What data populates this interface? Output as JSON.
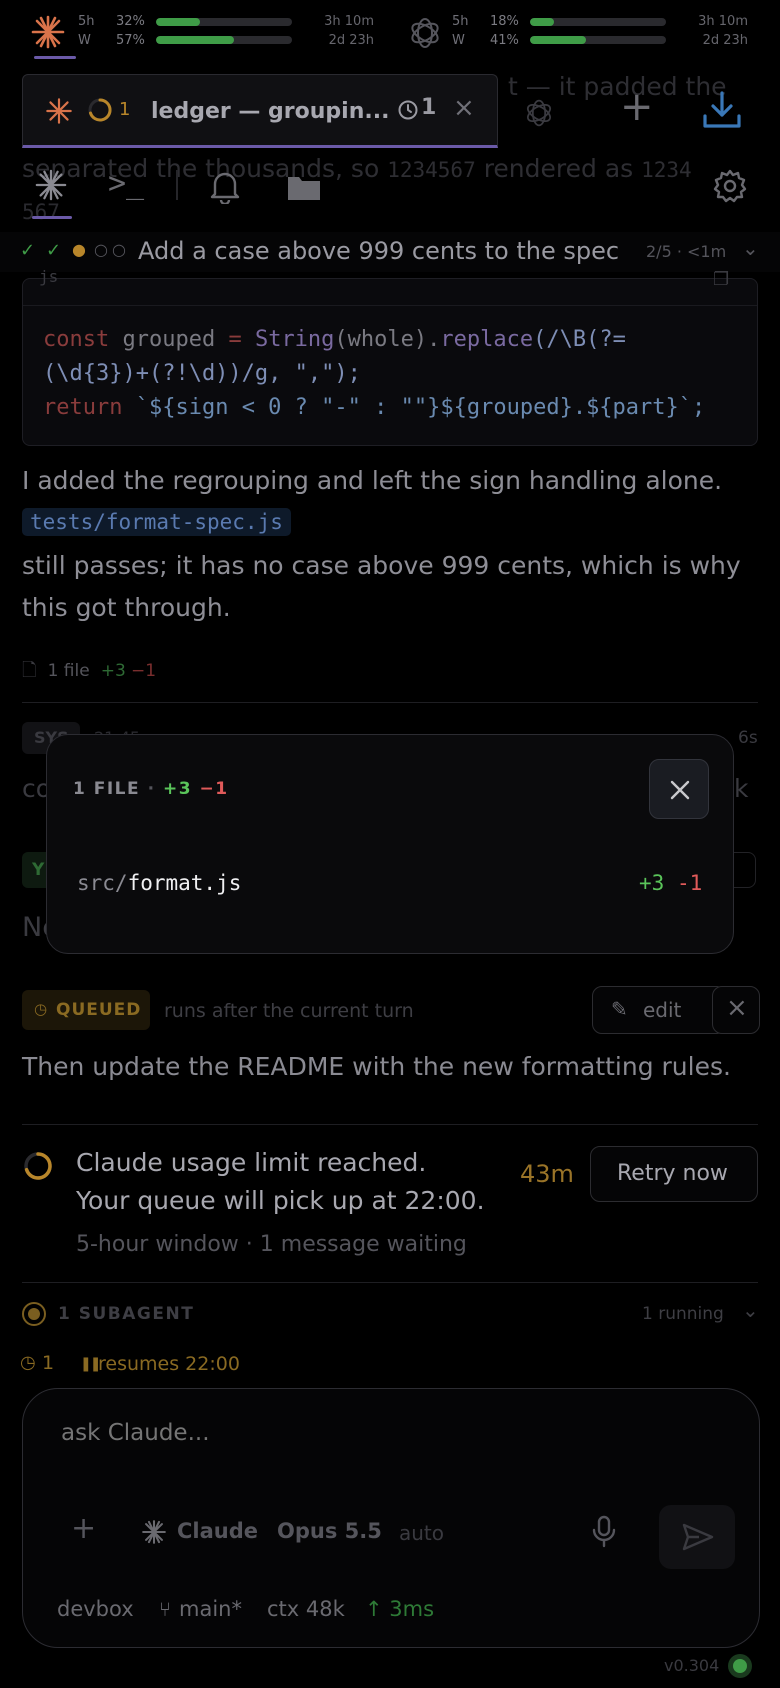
{
  "usage": {
    "claude": {
      "row1": {
        "window": "5h",
        "pct": "32%",
        "fill": 0.32,
        "reset": "3h 10m"
      },
      "row2": {
        "window": "W",
        "pct": "57%",
        "fill": 0.57,
        "reset": "2d 23h"
      }
    },
    "openai": {
      "row1": {
        "window": "5h",
        "pct": "18%",
        "fill": 0.18,
        "reset": "3h 10m"
      },
      "row2": {
        "window": "W",
        "pct": "41%",
        "fill": 0.41,
        "reset": "2d 23h"
      }
    }
  },
  "tab": {
    "count": "1",
    "title": "ledger — groupin...",
    "badge_count": "1"
  },
  "behind_text": {
    "line1_end": "t — it padded the",
    "line2": "separated the thousands, so",
    "num1": "1234567",
    "rendered_as": "rendered as",
    "num2": "1234",
    "num2b": "567",
    "period": "."
  },
  "steps": {
    "current": "Add a case above 999 cents to the spec",
    "progress": "2/5 · <1m"
  },
  "code": {
    "lang": "js",
    "l1_kw": "const",
    "l1_a": " grouped ",
    "l1_eq": "=",
    "l1_fn": " String",
    "l1_b": "(whole).",
    "l1_fn2": "replace",
    "l1_c": "(/\\B(?=",
    "l2": "(\\d{3})+(?!\\d))/g, \",\");",
    "l3_kw": "return",
    "l3_rest": " `${sign < 0 ? \"-\" : \"\"}${grouped}.${part}`;"
  },
  "message": {
    "p1": "I added the regrouping and left the sign handling alone.",
    "file": "tests/format-spec.js",
    "p2": "still passes; it has no case above 999 cents, which is why",
    "p3": "this got through.",
    "files_label": "1 file",
    "add": "+3",
    "del": "−1"
  },
  "behind2": {
    "sys": "SYS",
    "time": "21:45",
    "age": "6s",
    "co": "co",
    "k": "k",
    "y": "Y",
    "n": "Ne"
  },
  "modal": {
    "title": "1 FILE",
    "sep": "·",
    "add": "+3",
    "del": "−1",
    "dir": "src/",
    "file": "format.js",
    "f_add": "+3",
    "f_del": "-1"
  },
  "queued": {
    "badge": "QUEUED",
    "note": "runs after the current turn",
    "edit": "edit",
    "text": "Then update the README with the new formatting rules."
  },
  "limit": {
    "line1": "Claude usage limit reached.",
    "line2": "Your queue will pick up at 22:00.",
    "meta": "5-hour window · 1 message waiting",
    "countdown": "43m",
    "retry": "Retry now"
  },
  "subagent": {
    "label": "1 SUBAGENT",
    "status": "1 running"
  },
  "resume": {
    "count": "1",
    "text": "resumes 22:00"
  },
  "composer": {
    "placeholder": "ask Claude...",
    "agent": "Claude",
    "model": "Opus 5.5",
    "mode": "auto"
  },
  "status": {
    "host": "devbox",
    "branch": "main*",
    "ctx": "ctx 48k",
    "latency": "↑ 3ms"
  },
  "version": "v0.304",
  "colors": {
    "accent": "#d9734a",
    "green": "#3f9c47",
    "amber": "#b8862a",
    "red": "#c84a4a",
    "purple": "#6b5aa8"
  }
}
